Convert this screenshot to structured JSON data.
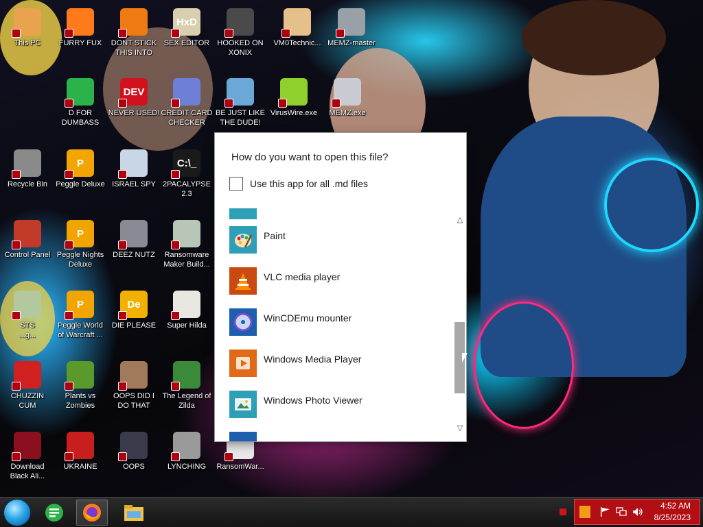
{
  "desktop": {
    "icons": [
      {
        "id": "this-pc",
        "label": "This PC",
        "bg": "#e9a24e",
        "glyph": ""
      },
      {
        "id": "furry-fux",
        "label": "FURRY FUX",
        "bg": "#ff7a1a",
        "glyph": ""
      },
      {
        "id": "dont-stick",
        "label": "DONT STICK\nTHIS INTO",
        "bg": "#f07a12",
        "glyph": ""
      },
      {
        "id": "sex-editor",
        "label": "SEX EDITOR",
        "bg": "#d8cfae",
        "glyph": "HxD"
      },
      {
        "id": "hooked-on-xonix",
        "label": "HOOKED ON\nXONIX",
        "bg": "#4a4a4a",
        "glyph": ""
      },
      {
        "id": "vm0technic",
        "label": "VM0Technic...",
        "bg": "#e6c08a",
        "glyph": ""
      },
      {
        "id": "memz-master",
        "label": "MEMZ-master",
        "bg": "#9aa0a8",
        "glyph": ""
      },
      {
        "id": "d-for-dumbass",
        "label": "D FOR\nDUMBASS",
        "bg": "#2bb34a",
        "glyph": ""
      },
      {
        "id": "never-used",
        "label": "NEVER USED!",
        "bg": "#d1121e",
        "glyph": "DEV"
      },
      {
        "id": "credit-card-checker",
        "label": "CREDIT CARD\nCHECKER",
        "bg": "#6e7fd8",
        "glyph": ""
      },
      {
        "id": "be-just-like-the-dude",
        "label": "BE JUST LIKE\nTHE DUDE!",
        "bg": "#6aa8d8",
        "glyph": ""
      },
      {
        "id": "viruswire",
        "label": "VirusWire.exe",
        "bg": "#8fd02c",
        "glyph": ""
      },
      {
        "id": "memz-exe",
        "label": "MEMZ.exe",
        "bg": "#c8ccd2",
        "glyph": ""
      },
      {
        "id": "recycle-bin",
        "label": "Recycle Bin",
        "bg": "#8a8a8a",
        "glyph": ""
      },
      {
        "id": "peggle-deluxe",
        "label": "Peggle Deluxe",
        "bg": "#f2a400",
        "glyph": "P"
      },
      {
        "id": "israel-spy",
        "label": "ISRAEL SPY",
        "bg": "#c9d6e6",
        "glyph": ""
      },
      {
        "id": "2pacalypse",
        "label": "2PACALYPSE\n2.3",
        "bg": "#1a1a1a",
        "glyph": "C:\\_"
      },
      {
        "id": "control-panel",
        "label": "Control Panel",
        "bg": "#c23a2a",
        "glyph": ""
      },
      {
        "id": "peggle-nights",
        "label": "Peggle Nights\nDeluxe",
        "bg": "#f2a400",
        "glyph": "P"
      },
      {
        "id": "deez-nutz",
        "label": "DEEZ NUTZ",
        "bg": "#8a8a94",
        "glyph": ""
      },
      {
        "id": "ransomware-maker",
        "label": "Ransomware\nMaker Build...",
        "bg": "#b8c6b8",
        "glyph": ""
      },
      {
        "id": "sts",
        "label": "STS\n...g...",
        "bg": "#b4c8a0",
        "glyph": ""
      },
      {
        "id": "peggle-world",
        "label": "Peggle World\nof Warcraft ...",
        "bg": "#f2a400",
        "glyph": "P"
      },
      {
        "id": "die-please",
        "label": "DIE PLEASE",
        "bg": "#f2b000",
        "glyph": "De"
      },
      {
        "id": "super-hilda",
        "label": "Super Hilda",
        "bg": "#e8e8e0",
        "glyph": ""
      },
      {
        "id": "chuzzin-cum",
        "label": "CHUZZIN\nCUM",
        "bg": "#d02020",
        "glyph": ""
      },
      {
        "id": "plants-vs-zombies",
        "label": "Plants vs\nZombies",
        "bg": "#5a9a2a",
        "glyph": ""
      },
      {
        "id": "oops-did-i-do-that",
        "label": "OOPS DID I\nDO THAT",
        "bg": "#a07a5a",
        "glyph": ""
      },
      {
        "id": "legend-of-zilda",
        "label": "The Legend of\nZilda",
        "bg": "#3a8a3a",
        "glyph": ""
      },
      {
        "id": "download-black",
        "label": "Download\nBlack Ali...",
        "bg": "#8a1020",
        "glyph": ""
      },
      {
        "id": "ukraine",
        "label": "UKRAINE",
        "bg": "#c81e1e",
        "glyph": ""
      },
      {
        "id": "oops",
        "label": "OOPS",
        "bg": "#3a3a4a",
        "glyph": ""
      },
      {
        "id": "lynching",
        "label": "LYNCHING",
        "bg": "#9a9a9a",
        "glyph": ""
      },
      {
        "id": "ransomwar",
        "label": "RansomWar...",
        "bg": "#e8e8e8",
        "glyph": ""
      }
    ]
  },
  "dialog": {
    "title": "How do you want to open this file?",
    "checkbox_label": "Use this app for all .md files",
    "checkbox_checked": false,
    "apps": [
      {
        "name": "Paint",
        "icon": "paint-icon",
        "color": "#2f9fb8"
      },
      {
        "name": "VLC media player",
        "icon": "vlc-icon",
        "color": "#f08a00"
      },
      {
        "name": "WinCDEmu mounter",
        "icon": "disc-icon",
        "color": "#1d5fae"
      },
      {
        "name": "Windows Media Player",
        "icon": "media-player-icon",
        "color": "#e06a18"
      },
      {
        "name": "Windows Photo Viewer",
        "icon": "photo-viewer-icon",
        "color": "#2f9fb8"
      }
    ]
  },
  "taskbar": {
    "items": [
      {
        "name": "start-orb"
      },
      {
        "name": "chat-app",
        "color": "#2bb34a"
      },
      {
        "name": "firefox",
        "color": "#ff7a1a"
      },
      {
        "name": "file-explorer",
        "color": "#f3c24a"
      }
    ]
  },
  "clock": {
    "time": "4:52 AM",
    "date": "8/25/2023"
  },
  "colors": {
    "tray_bg": "#b20f15",
    "dialog_bg": "#ffffff",
    "scroll_thumb": "#a8a8a8"
  }
}
